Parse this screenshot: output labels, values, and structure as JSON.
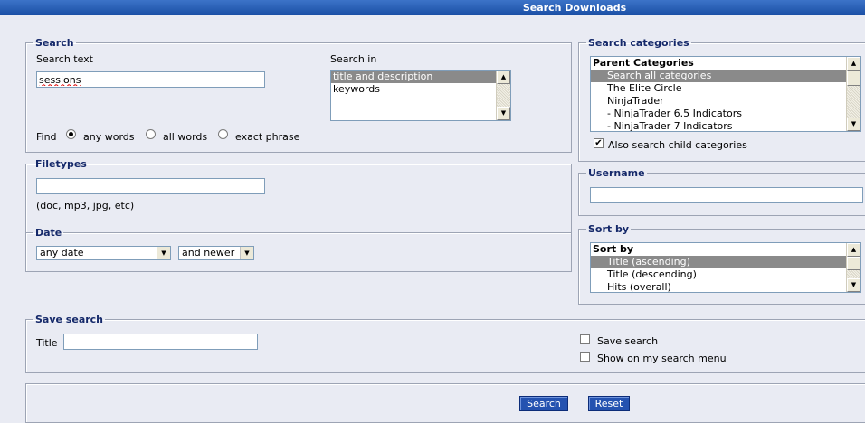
{
  "title": "Search Downloads",
  "search": {
    "legend": "Search",
    "text_label": "Search text",
    "text_value": "sessions",
    "in_label": "Search in",
    "in_options": [
      "title and description",
      "keywords"
    ],
    "find_label": "Find",
    "find_options": [
      "any words",
      "all words",
      "exact phrase"
    ],
    "find_selected": "any words"
  },
  "filetypes": {
    "legend": "Filetypes",
    "value": "",
    "hint": "(doc, mp3, jpg, etc)"
  },
  "date": {
    "legend": "Date",
    "range_value": "any date",
    "direction_value": "and newer"
  },
  "categories": {
    "legend": "Search categories",
    "options": [
      {
        "label": "Parent Categories",
        "group": true
      },
      {
        "label": "Search all categories",
        "selected": true
      },
      {
        "label": "The Elite Circle"
      },
      {
        "label": "NinjaTrader"
      },
      {
        "label": "- NinjaTrader 6.5 Indicators"
      },
      {
        "label": "- NinjaTrader 7 Indicators"
      }
    ],
    "child_label": "Also search child categories",
    "child_checked": true
  },
  "username": {
    "legend": "Username",
    "value": ""
  },
  "sortby": {
    "legend": "Sort by",
    "options": [
      {
        "label": "Sort by",
        "group": true
      },
      {
        "label": "Title (ascending)",
        "selected": true
      },
      {
        "label": "Title (descending)"
      },
      {
        "label": "Hits (overall)"
      }
    ]
  },
  "save": {
    "legend": "Save search",
    "title_label": "Title",
    "title_value": "",
    "save_label": "Save search",
    "menu_label": "Show on my search menu"
  },
  "buttons": {
    "search": "Search",
    "reset": "Reset"
  },
  "colors": {
    "titlebar": "#1a4fa5",
    "legend": "#15296a",
    "button": "#2452b0",
    "selected_option": "#8a8a8a"
  }
}
